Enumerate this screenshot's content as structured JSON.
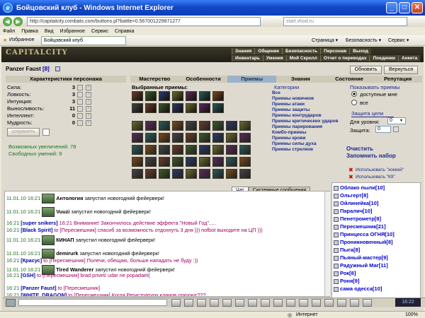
{
  "window": {
    "title": "Бойцовский клуб - Windows Internet Explorer"
  },
  "browser": {
    "url": "http://capitalcity.combats.com/buttons.pl?battle=0.567001229871277",
    "search_placeholder": "start.vhod.ru",
    "menu": [
      "Файл",
      "Правка",
      "Вид",
      "Избранное",
      "Сервис",
      "Справка"
    ],
    "fav_label": "Избранное",
    "tab_label": "Бойцовский клуб",
    "tools": [
      "Страница ▾",
      "Безопасность ▾",
      "Сервис ▾"
    ],
    "status": "Интернет",
    "zoom": "100%"
  },
  "game": {
    "logo": "CAPITALCITY",
    "topnav1": [
      "Знания",
      "Общение",
      "Безопасность",
      "Персонаж",
      "Выход"
    ],
    "topnav2": [
      "Инвентарь",
      "Умения",
      "Мой Скролл",
      "Отчет о переводах",
      "Поединки",
      "Анкета"
    ],
    "player": "Panzer Faust",
    "player_level": "[8]",
    "refresh_button": "Обновить",
    "back_button": "Вернуться",
    "stats_header": "Характеристики персонажа",
    "stats": [
      {
        "label": "Сила:",
        "value": "3"
      },
      {
        "label": "Ловкость:",
        "value": "3"
      },
      {
        "label": "Интуиция:",
        "value": "3"
      },
      {
        "label": "Выносливость:",
        "value": "11"
      },
      {
        "label": "Интеллект:",
        "value": "0"
      },
      {
        "label": "Мудрость:",
        "value": "0"
      }
    ],
    "save_button": "сохранить",
    "upgrades": "Возможных увеличений: 78",
    "free_skills": "Свободных умений: 9",
    "tabs": [
      "Мастерство",
      "Особенности",
      "Приемы",
      "Знания",
      "Состояние",
      "Репутация"
    ],
    "selected_title": "Выбранные приемы:",
    "categories_title": "Категории",
    "categories": [
      "Все",
      "Приемы новичков",
      "Приемы атаки",
      "Приемы защиты",
      "Приемы контрударов",
      "Приемы критических ударов",
      "Приемы парирования",
      "Комбо-приемы",
      "Приемы крови",
      "Приемы силы духа",
      "Приемы стрелков"
    ],
    "show_title": "Показывать приемы",
    "show_available": "доступные мне",
    "show_all": "все",
    "protect_title": "Защита цели",
    "level_label": "Для уровня:",
    "level_value": "0",
    "protect_label": "Защита:",
    "protect_value": "0",
    "clear": "Очистить",
    "remember": "Запомнить набор",
    "using1": "Использовать \"хоккей\"",
    "using2": "Использовать \"К9\""
  },
  "chat": {
    "tabs": [
      "Чат",
      "Системные сообщения"
    ],
    "lines": [
      {
        "ts": "11.01.10 16:21",
        "av": true,
        "name": "Антология",
        "text": "запустил новогодний фейерверк!"
      },
      {
        "ts": "11.01.10 16:21",
        "av": true,
        "name": "Vuuzi",
        "text": "запустил новогодний фейерверк!"
      },
      {
        "ts": "16:21",
        "name": "[super snikers]",
        "text": "16:21 Внимание! Закончилось действие эффекта \"Новый Год\"....."
      },
      {
        "ts": "16:21",
        "name": "[Black Spirit]",
        "text": "to [Пересмешник] спасиб за возможность отдохнуть 3 дня ))) поfbot выходите на ЦП )))"
      },
      {
        "ts": "11.01.10 16:21",
        "av": true,
        "name": "КИНАП",
        "text": "запустил новогодний фейерверк!"
      },
      {
        "ts": "11.01.10 16:21",
        "av": true,
        "name": "demirurk",
        "text": "запустил новогодний фейерверк!"
      },
      {
        "ts": "16:21",
        "name": "[Красус]",
        "text": "to [Пересмешник] Полечи, обещаю, больше нападать не буду :))"
      },
      {
        "ts": "11.01.10 16:21",
        "av": true,
        "name": "Tired Wanderer",
        "text": "запустил новогодний фейерверк!"
      },
      {
        "ts": "16:21",
        "name": "[GSH]",
        "text": "to [Пересмешник] brad privet/ udar ne popadaet("
      },
      {
        "ts": "16:21",
        "name": "[Panzer Faust]",
        "text": "to [Пересмешник]"
      },
      {
        "ts": "16:21",
        "name": "[WHITE_DRAGON]",
        "text": "to [Пересмешник] Когда Регистратуру кланов откроют???"
      }
    ]
  },
  "users": [
    "Облако пыли[10]",
    "Ольгерт[8]",
    "Ойлинейка[10]",
    "Паралич[10]",
    "Пенетрометр[8]",
    "Пересмешник[21]",
    "Принцесса ОГНЯ[10]",
    "Проникновенный[8]",
    "Пыга[8]",
    "Пьяный-мастер[9]",
    "Радужный Маг[11]",
    "Рок[8]",
    "Роня[9]",
    "сама одесса[10]"
  ]
}
